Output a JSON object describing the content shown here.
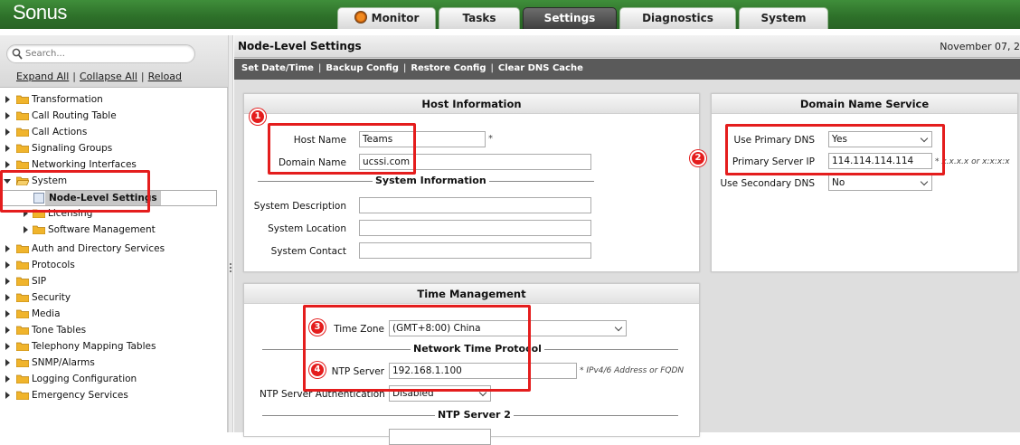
{
  "app": {
    "logo": "Sonus"
  },
  "tabs": [
    {
      "label": "Monitor"
    },
    {
      "label": "Tasks"
    },
    {
      "label": "Settings"
    },
    {
      "label": "Diagnostics"
    },
    {
      "label": "System"
    }
  ],
  "sidebar": {
    "search_placeholder": "Search...",
    "expand_all": "Expand All",
    "collapse_all": "Collapse All",
    "reload": "Reload",
    "sep": "|",
    "items": [
      "Transformation",
      "Call Routing Table",
      "Call Actions",
      "Signaling Groups",
      "Networking Interfaces",
      "System",
      "Node-Level Settings",
      "Licensing",
      "Software Management",
      "Auth and Directory Services",
      "Protocols",
      "SIP",
      "Security",
      "Media",
      "Tone Tables",
      "Telephony Mapping Tables",
      "SNMP/Alarms",
      "Logging Configuration",
      "Emergency Services"
    ]
  },
  "main": {
    "title": "Node-Level Settings",
    "date": "November 07, 2",
    "actions": [
      "Set Date/Time",
      "Backup Config",
      "Restore Config",
      "Clear DNS Cache"
    ],
    "action_sep": "|"
  },
  "host": {
    "title": "Host Information",
    "host_name_label": "Host Name",
    "host_name_value": "Teams",
    "required": "*",
    "domain_name_label": "Domain Name",
    "domain_name_value": "ucssi.com",
    "system_info_title": "System Information",
    "system_description_label": "System Description",
    "system_location_label": "System Location",
    "system_contact_label": "System Contact"
  },
  "dns": {
    "title": "Domain Name Service",
    "use_primary_label": "Use Primary DNS",
    "use_primary_value": "Yes",
    "primary_ip_label": "Primary Server IP",
    "primary_ip_value": "114.114.114.114",
    "primary_ip_hint": "* x.x.x.x or x:x:x:x",
    "use_secondary_label": "Use Secondary DNS",
    "use_secondary_value": "No"
  },
  "time": {
    "title": "Time Management",
    "timezone_label": "Time Zone",
    "timezone_value": "(GMT+8:00) China",
    "ntp_title": "Network Time Protocol",
    "ntp_server_label": "NTP Server",
    "ntp_server_value": "192.168.1.100",
    "ntp_server_hint": "* IPv4/6 Address or FQDN",
    "ntp_auth_label": "NTP Server Authentication",
    "ntp_auth_value": "Disabled",
    "ntp2_title": "NTP Server 2"
  },
  "annotations": [
    "1",
    "2",
    "3",
    "4"
  ],
  "colors": {
    "header_green": "#2d6f29",
    "annotation_red": "#e41d1d",
    "action_bar": "#5a5a5a"
  }
}
